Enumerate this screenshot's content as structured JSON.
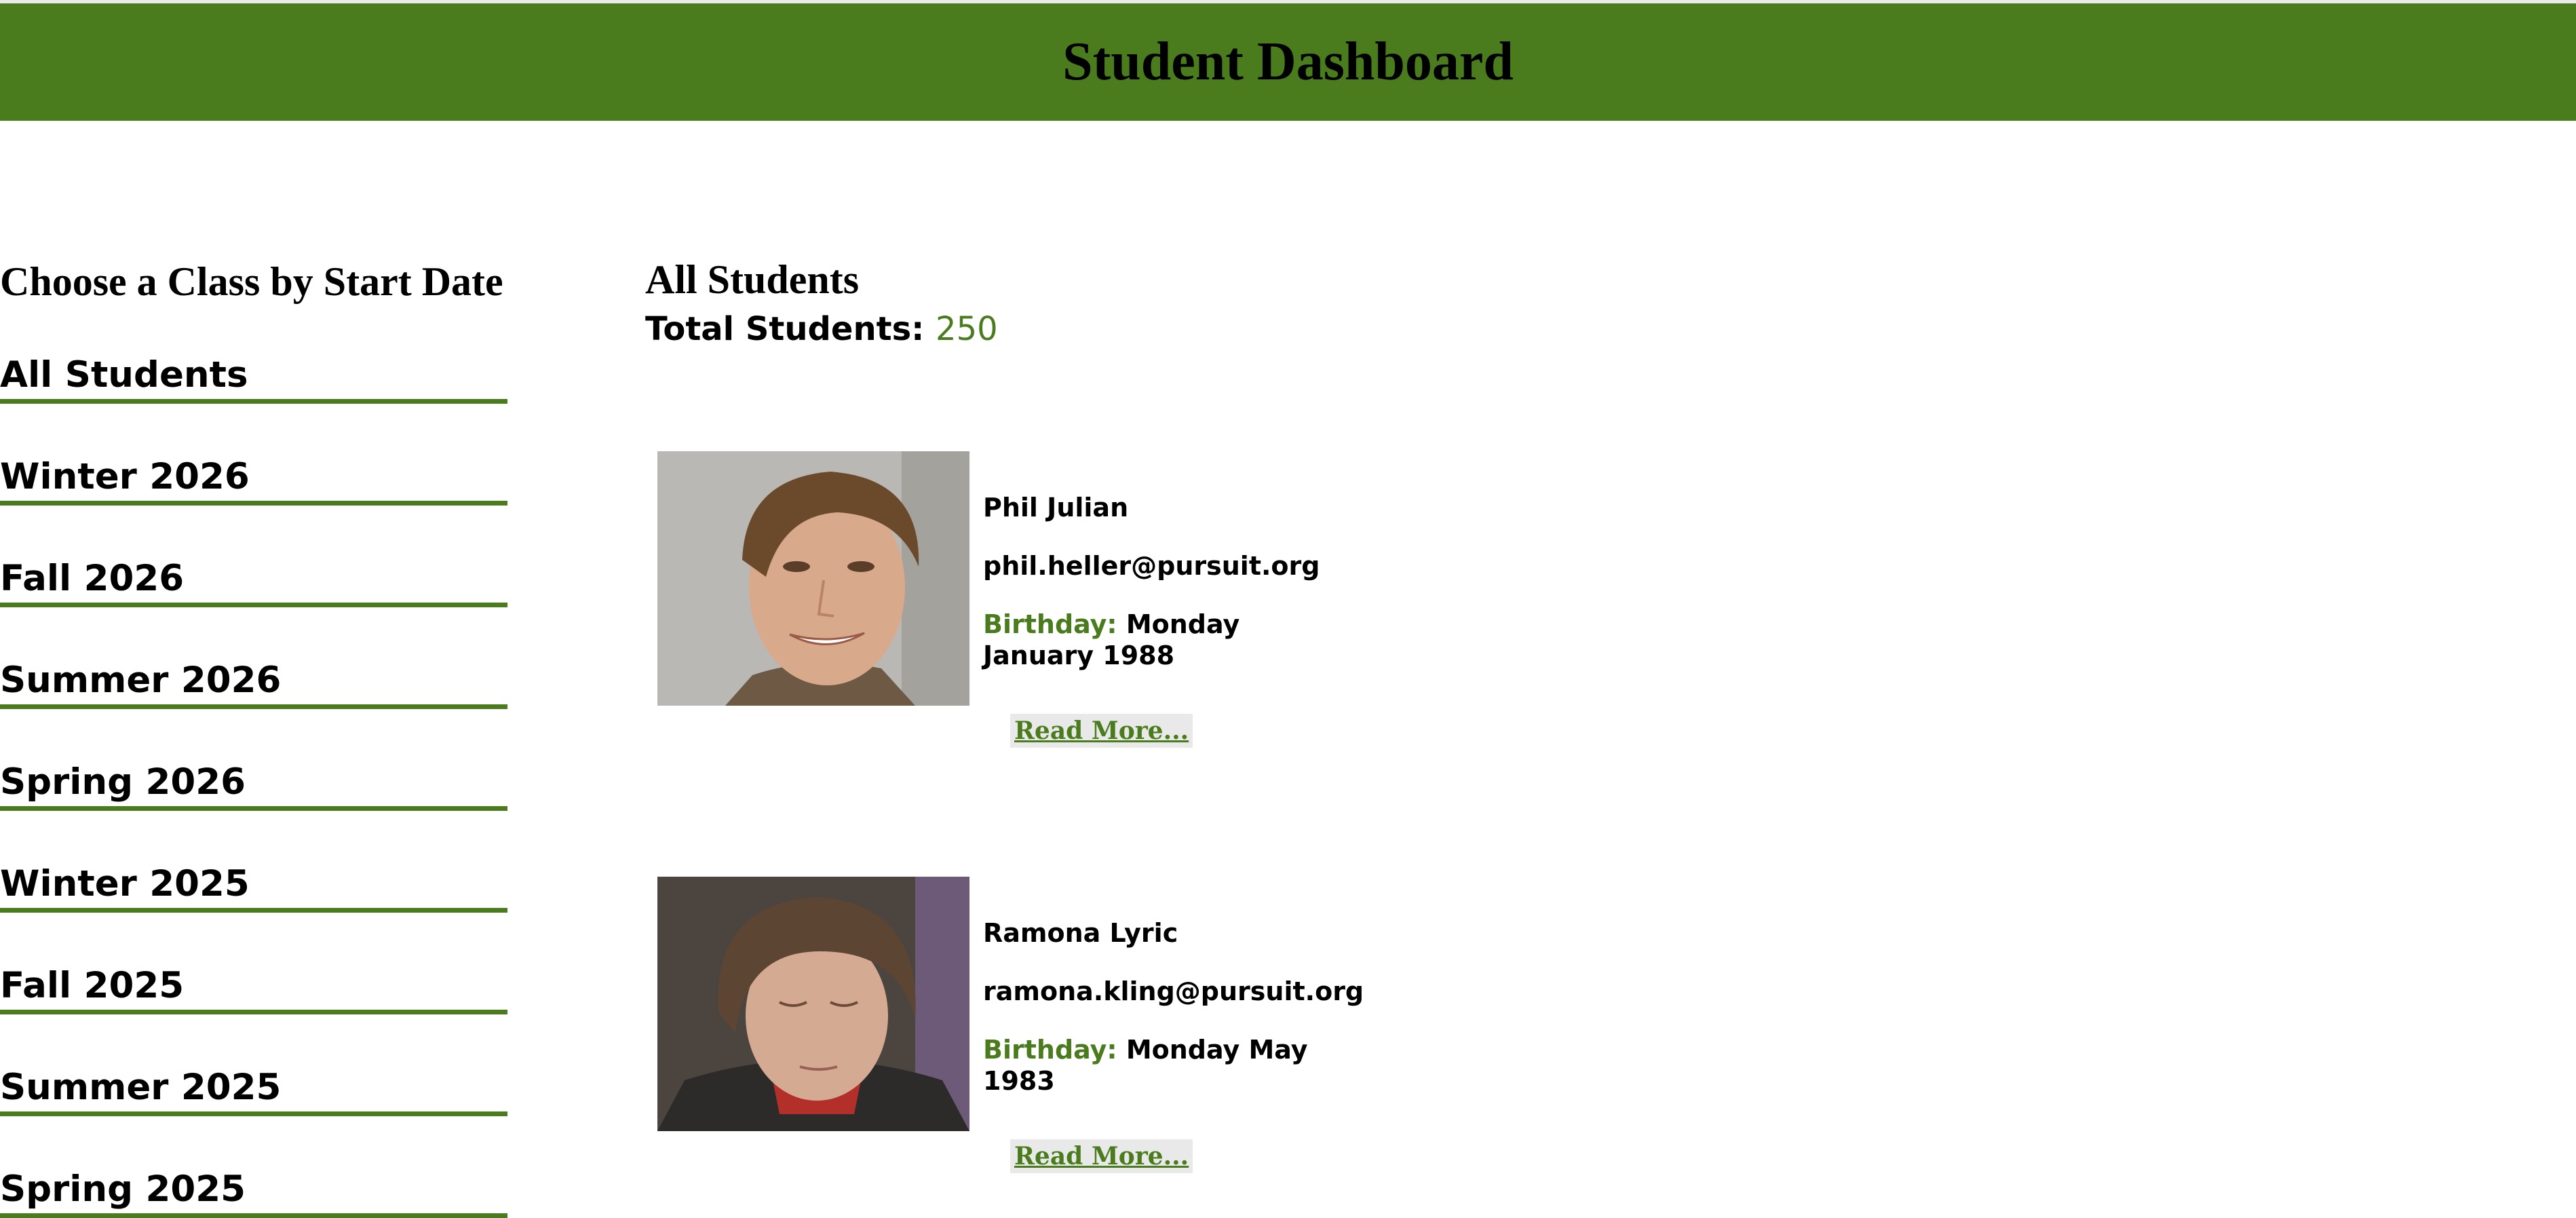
{
  "header": {
    "title": "Student Dashboard"
  },
  "sidebar": {
    "heading": "Choose a Class by Start Date",
    "items": [
      {
        "label": "All Students"
      },
      {
        "label": "Winter 2026"
      },
      {
        "label": "Fall 2026"
      },
      {
        "label": "Summer 2026"
      },
      {
        "label": "Spring 2026"
      },
      {
        "label": "Winter 2025"
      },
      {
        "label": "Fall 2025"
      },
      {
        "label": "Summer 2025"
      },
      {
        "label": "Spring 2025"
      }
    ]
  },
  "main": {
    "title": "All Students",
    "total_label": "Total Students:",
    "total_count": "250",
    "students": [
      {
        "name": "Phil Julian",
        "email": "phil.heller@pursuit.org",
        "birthday_label": "Birthday:",
        "birthday": "Monday January 1988",
        "read_more": "Read More..."
      },
      {
        "name": "Ramona Lyric",
        "email": "ramona.kling@pursuit.org",
        "birthday_label": "Birthday:",
        "birthday": "Monday May 1983",
        "read_more": "Read More..."
      }
    ]
  },
  "colors": {
    "accent": "#4a7c1e",
    "button_bg": "#e9e9e9"
  }
}
